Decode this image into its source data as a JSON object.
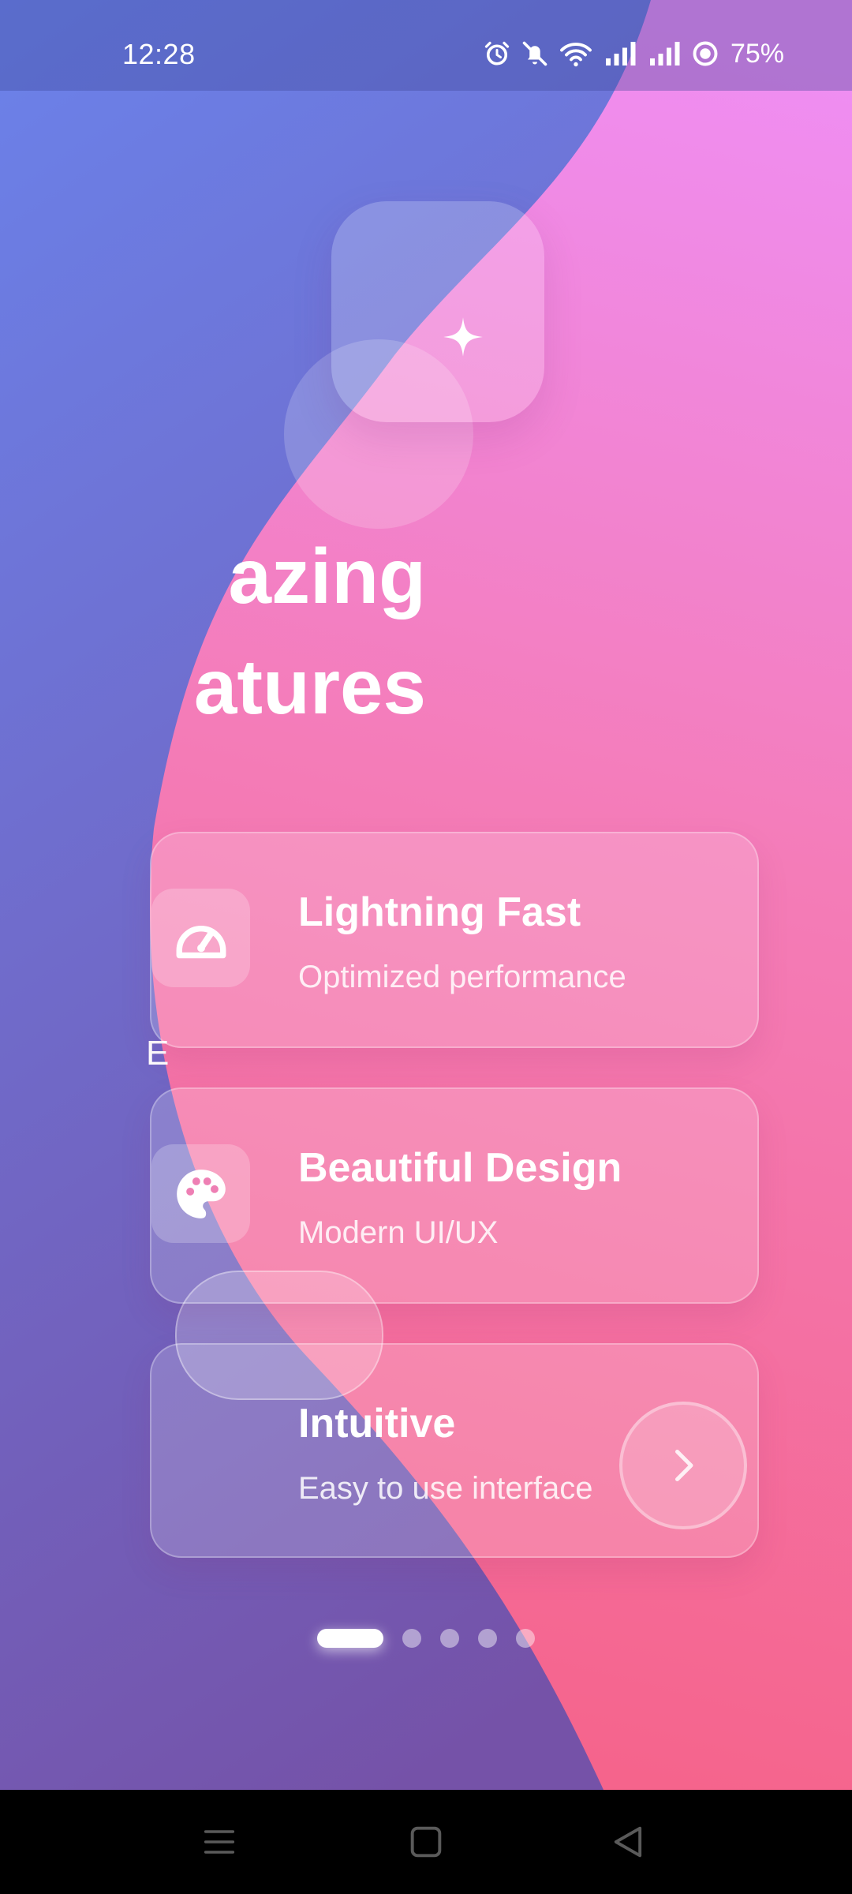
{
  "status_bar": {
    "time": "12:28",
    "battery": "75%",
    "icons": [
      "alarm-icon",
      "bell-muted-icon",
      "wifi-icon",
      "signal-icon",
      "signal-icon",
      "battery-ring-icon"
    ]
  },
  "onboarding": {
    "headline_line1": "azing",
    "headline_line2": "atures",
    "stray_letter": "E",
    "features": [
      {
        "title": "Lightning Fast",
        "subtitle": "Optimized performance",
        "icon": "speedometer-icon"
      },
      {
        "title": "Beautiful Design",
        "subtitle": "Modern UI/UX",
        "icon": "palette-icon"
      },
      {
        "title": "Intuitive",
        "subtitle": "Easy to use interface",
        "icon": "none"
      }
    ],
    "next_icon": "chevron-right-icon",
    "pager": {
      "total": 5,
      "active": 1
    }
  },
  "colors": {
    "blue_top": "#6b82ea",
    "blue_bottom": "#7552a8",
    "pink_top": "#ef8ef3",
    "pink_bottom": "#f5638a"
  },
  "nav_bar": {
    "icons": [
      "menu-icon",
      "home-square-icon",
      "back-triangle-icon"
    ]
  }
}
